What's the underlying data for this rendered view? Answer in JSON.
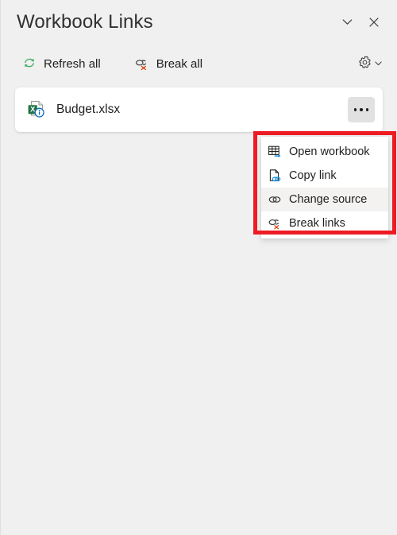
{
  "pane": {
    "title": "Workbook Links",
    "collapse_icon": "chevron-down-icon",
    "close_icon": "close-icon"
  },
  "toolbar": {
    "refresh_all_label": "Refresh all",
    "refresh_all_icon": "refresh-icon",
    "break_all_label": "Break all",
    "break_all_icon": "break-link-icon",
    "settings_icon": "gear-icon",
    "settings_chevron_icon": "chevron-down-icon"
  },
  "links": {
    "items": [
      {
        "name": "Budget.xlsx",
        "icon": "excel-file-info-icon",
        "more_icon": "more-options-icon"
      }
    ]
  },
  "context_menu": {
    "items": [
      {
        "label": "Open workbook",
        "icon": "open-workbook-icon",
        "selected": false
      },
      {
        "label": "Copy link",
        "icon": "copy-link-icon",
        "selected": false
      },
      {
        "label": "Change source",
        "icon": "change-source-icon",
        "selected": true
      },
      {
        "label": "Break links",
        "icon": "break-links-icon",
        "selected": false
      }
    ]
  },
  "colors": {
    "background": "#f0f0f0",
    "card": "#ffffff",
    "text": "#201f1e",
    "annotation": "#ed1c24",
    "excel_green": "#217346",
    "link_blue": "#0078d4",
    "refresh_green": "#2eab55",
    "error_red": "#d83b01",
    "hover": "#f3f2f1"
  }
}
